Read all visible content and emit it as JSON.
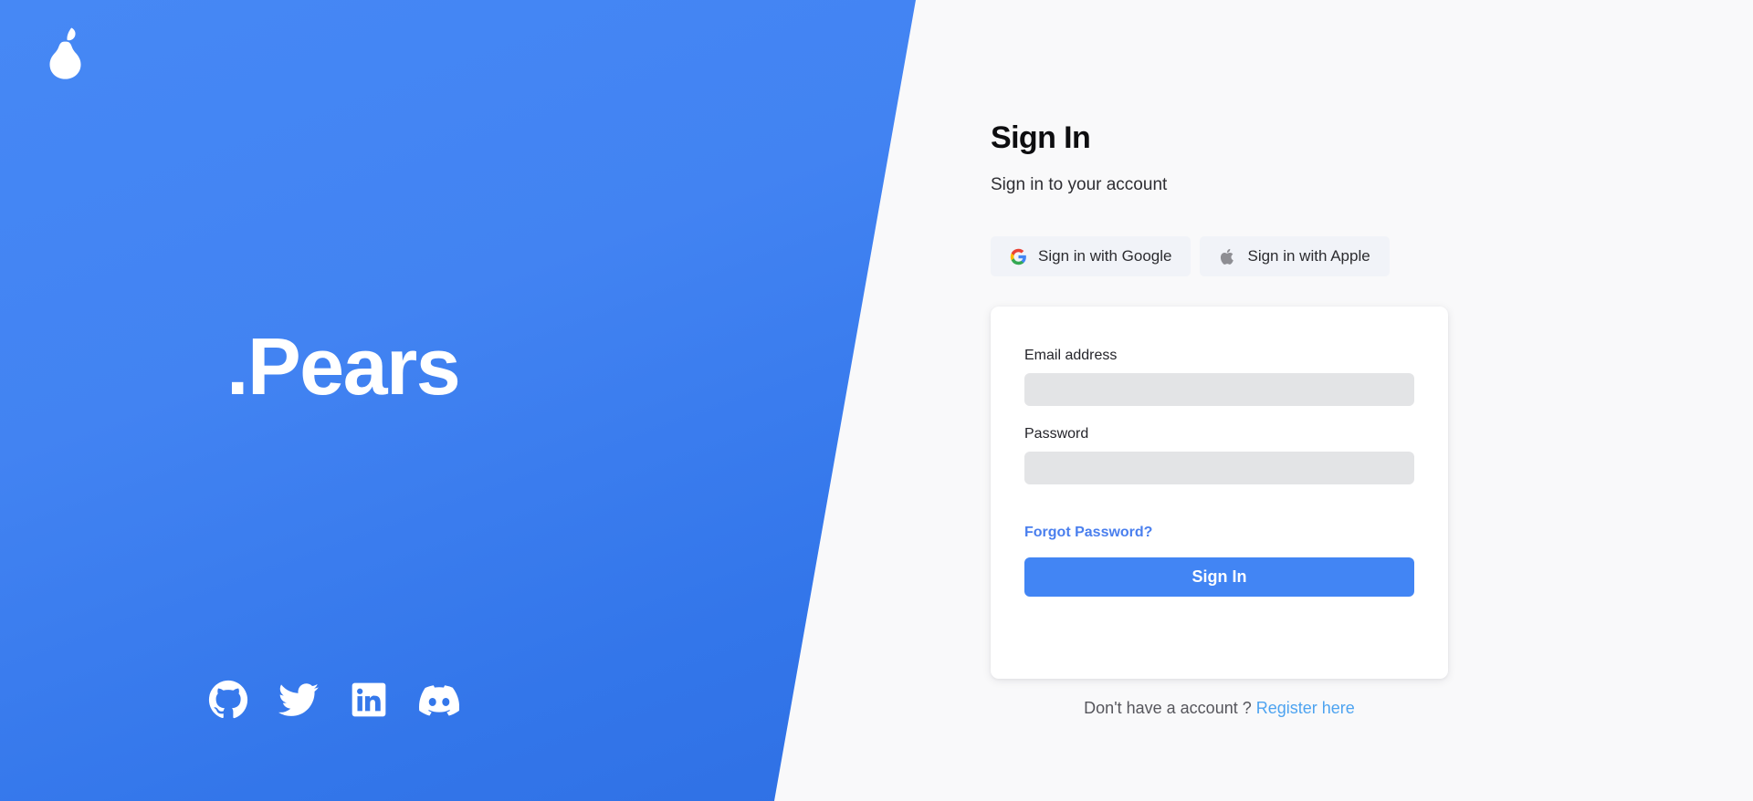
{
  "brand": {
    "logo_icon": "pear-icon",
    "wordmark": ".Pears",
    "social_links": [
      {
        "name": "github",
        "icon": "github-icon",
        "label": "GitHub"
      },
      {
        "name": "twitter",
        "icon": "twitter-icon",
        "label": "Twitter"
      },
      {
        "name": "linkedin",
        "icon": "linkedin-icon",
        "label": "LinkedIn"
      },
      {
        "name": "discord",
        "icon": "discord-icon",
        "label": "Discord"
      }
    ]
  },
  "auth": {
    "title": "Sign In",
    "subtitle": "Sign in to your account",
    "oauth": {
      "google": {
        "label": "Sign in with Google",
        "icon": "google-g-icon"
      },
      "apple": {
        "label": "Sign in with Apple",
        "icon": "apple-icon"
      }
    },
    "form": {
      "email_label": "Email address",
      "email_value": "",
      "email_placeholder": "",
      "password_label": "Password",
      "password_value": "",
      "password_placeholder": "",
      "forgot_label": "Forgot Password?",
      "submit_label": "Sign In"
    },
    "footer": {
      "prompt": "Don't have a account ?",
      "register_label": "Register here"
    }
  },
  "colors": {
    "brand_blue_top": "#4688f5",
    "brand_blue_bottom": "#2f70e4",
    "accent": "#4285f4",
    "link_blue": "#4a7fee",
    "register_blue": "#4da3f0",
    "page_background": "#f9f9fa",
    "input_background": "#e3e4e6",
    "oauth_background": "#f1f3f8"
  }
}
